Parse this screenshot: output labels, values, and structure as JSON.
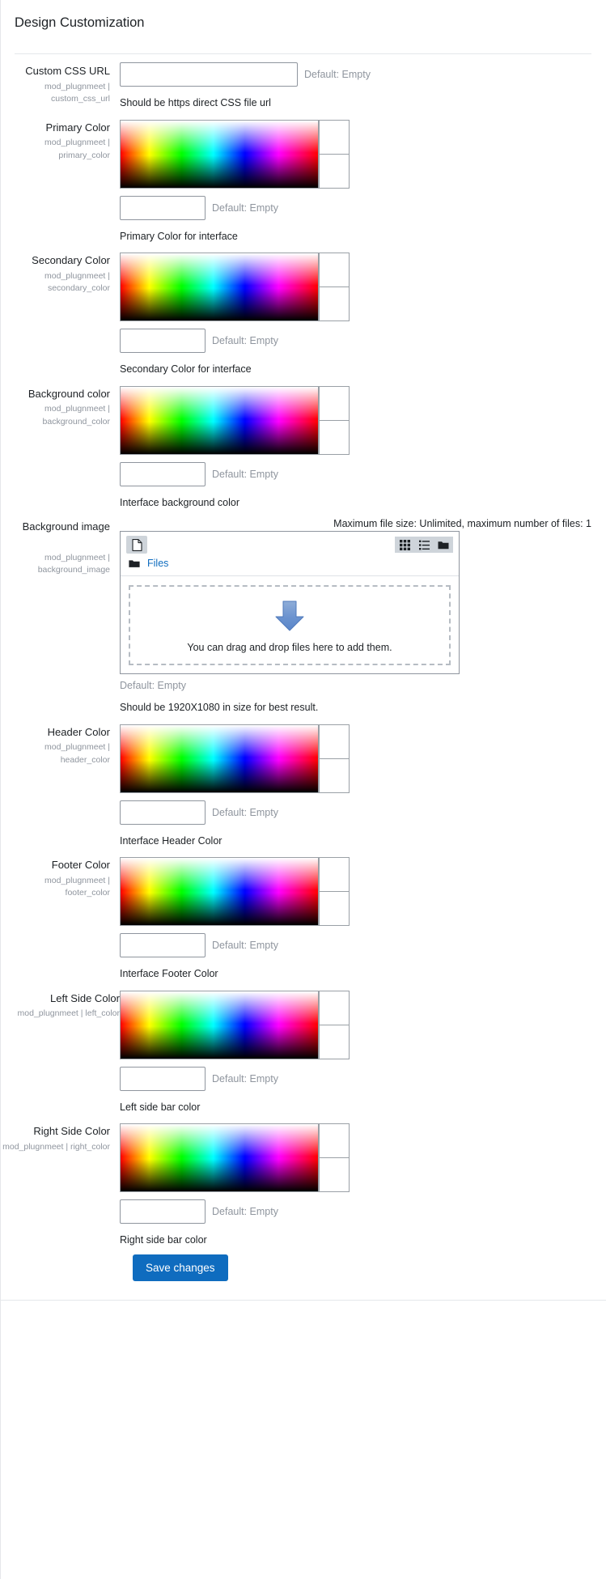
{
  "header": {
    "title": "Design Customization"
  },
  "labels": {
    "default_empty": "Default: Empty",
    "save_changes": "Save changes"
  },
  "settings": [
    {
      "id": "custom_css_url",
      "type": "text",
      "name": "Custom CSS URL",
      "key": "mod_plugnmeet | custom_css_url",
      "value": "",
      "default_text": "Default: Empty",
      "helper": "Should be https direct CSS file url"
    },
    {
      "id": "primary_color",
      "type": "color",
      "name": "Primary Color",
      "key": "mod_plugnmeet | primary_color",
      "value": "",
      "default_text": "Default: Empty",
      "helper": "Primary Color for interface"
    },
    {
      "id": "secondary_color",
      "type": "color",
      "name": "Secondary Color",
      "key": "mod_plugnmeet | secondary_color",
      "value": "",
      "default_text": "Default: Empty",
      "helper": "Secondary Color for interface"
    },
    {
      "id": "background_color",
      "type": "color",
      "name": "Background color",
      "key": "mod_plugnmeet | background_color",
      "value": "",
      "default_text": "Default: Empty",
      "helper": "Interface background color"
    },
    {
      "id": "background_image",
      "type": "file",
      "name": "Background image",
      "key": "mod_plugnmeet | background_image",
      "limits": "Maximum file size: Unlimited, maximum number of files: 1",
      "breadcrumb": "Files",
      "dropzone_text": "You can drag and drop files here to add them.",
      "default_text": "Default: Empty",
      "helper": "Should be 1920X1080 in size for best result."
    },
    {
      "id": "header_color",
      "type": "color",
      "name": "Header Color",
      "key": "mod_plugnmeet | header_color",
      "value": "",
      "default_text": "Default: Empty",
      "helper": "Interface Header Color"
    },
    {
      "id": "footer_color",
      "type": "color",
      "name": "Footer Color",
      "key": "mod_plugnmeet | footer_color",
      "value": "",
      "default_text": "Default: Empty",
      "helper": "Interface Footer Color"
    },
    {
      "id": "left_color",
      "type": "color",
      "name": "Left Side Color",
      "key": "mod_plugnmeet | left_color",
      "value": "",
      "default_text": "Default: Empty",
      "helper": "Left side bar color"
    },
    {
      "id": "right_color",
      "type": "color",
      "name": "Right Side Color",
      "key": "mod_plugnmeet | right_color",
      "value": "",
      "default_text": "Default: Empty",
      "helper": "Right side bar color"
    }
  ],
  "icons": {
    "add_file": "file-icon",
    "grid_view": "grid-view-icon",
    "list_view": "list-view-icon",
    "tree_view": "folder-view-icon",
    "folder": "folder-icon",
    "drop_arrow": "down-arrow-icon"
  },
  "colors": {
    "accent": "#0f6cbf",
    "link": "#0f6cbf",
    "muted": "#8f959e",
    "border": "#8f959e",
    "text": "#1d2125"
  }
}
